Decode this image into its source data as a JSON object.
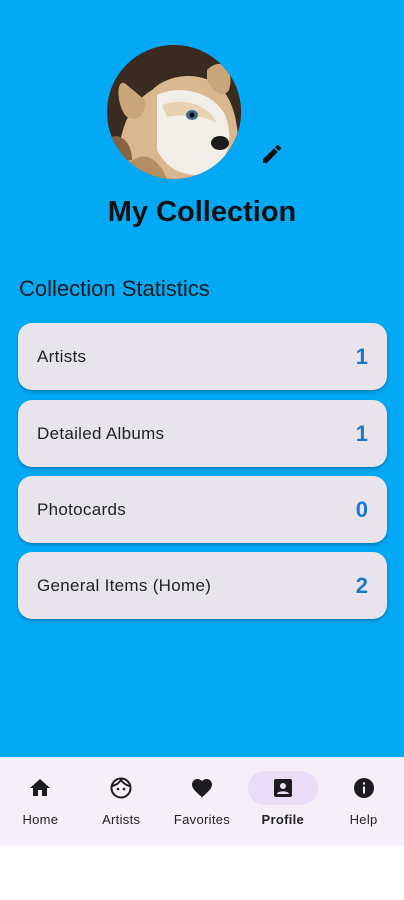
{
  "header": {
    "title": "My Collection",
    "avatar_icon": "dog-photo",
    "edit_icon": "pencil-icon"
  },
  "stats": {
    "section_title": "Collection Statistics",
    "items": [
      {
        "label": "Artists",
        "value": "1"
      },
      {
        "label": "Detailed Albums",
        "value": "1"
      },
      {
        "label": "Photocards",
        "value": "0"
      },
      {
        "label": "General Items (Home)",
        "value": "2"
      }
    ]
  },
  "nav": {
    "items": [
      {
        "label": "Home",
        "icon": "home-icon"
      },
      {
        "label": "Artists",
        "icon": "face-icon"
      },
      {
        "label": "Favorites",
        "icon": "heart-icon"
      },
      {
        "label": "Profile",
        "icon": "profile-icon",
        "active": true
      },
      {
        "label": "Help",
        "icon": "info-icon"
      }
    ]
  },
  "colors": {
    "background": "#03A9F4",
    "card": "#E8E4EB",
    "value": "#1E78C8",
    "nav_background": "#F4EFF8",
    "nav_active_pill": "#E9DDF8"
  }
}
